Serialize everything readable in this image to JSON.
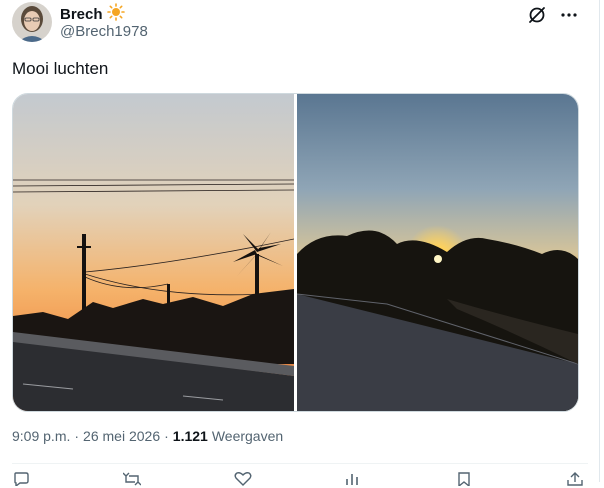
{
  "post": {
    "author_name": "Brech",
    "handle": "@Brech1978",
    "text": "Mooi luchten",
    "time": "9:09 p.m.",
    "date": "26 mei 2026",
    "views_count": "1.121",
    "views_label": "Weergaven"
  },
  "icons": {
    "name_badge": "sun-icon",
    "grok": "grok-icon",
    "more": "more-icon",
    "actions": [
      "reply-icon",
      "repost-icon",
      "like-icon",
      "views-icon",
      "bookmark-icon",
      "share-icon"
    ]
  },
  "colors": {
    "accent": "#1d9bf0",
    "sun_badge": "#f5a623",
    "secondary_text": "#536471"
  }
}
